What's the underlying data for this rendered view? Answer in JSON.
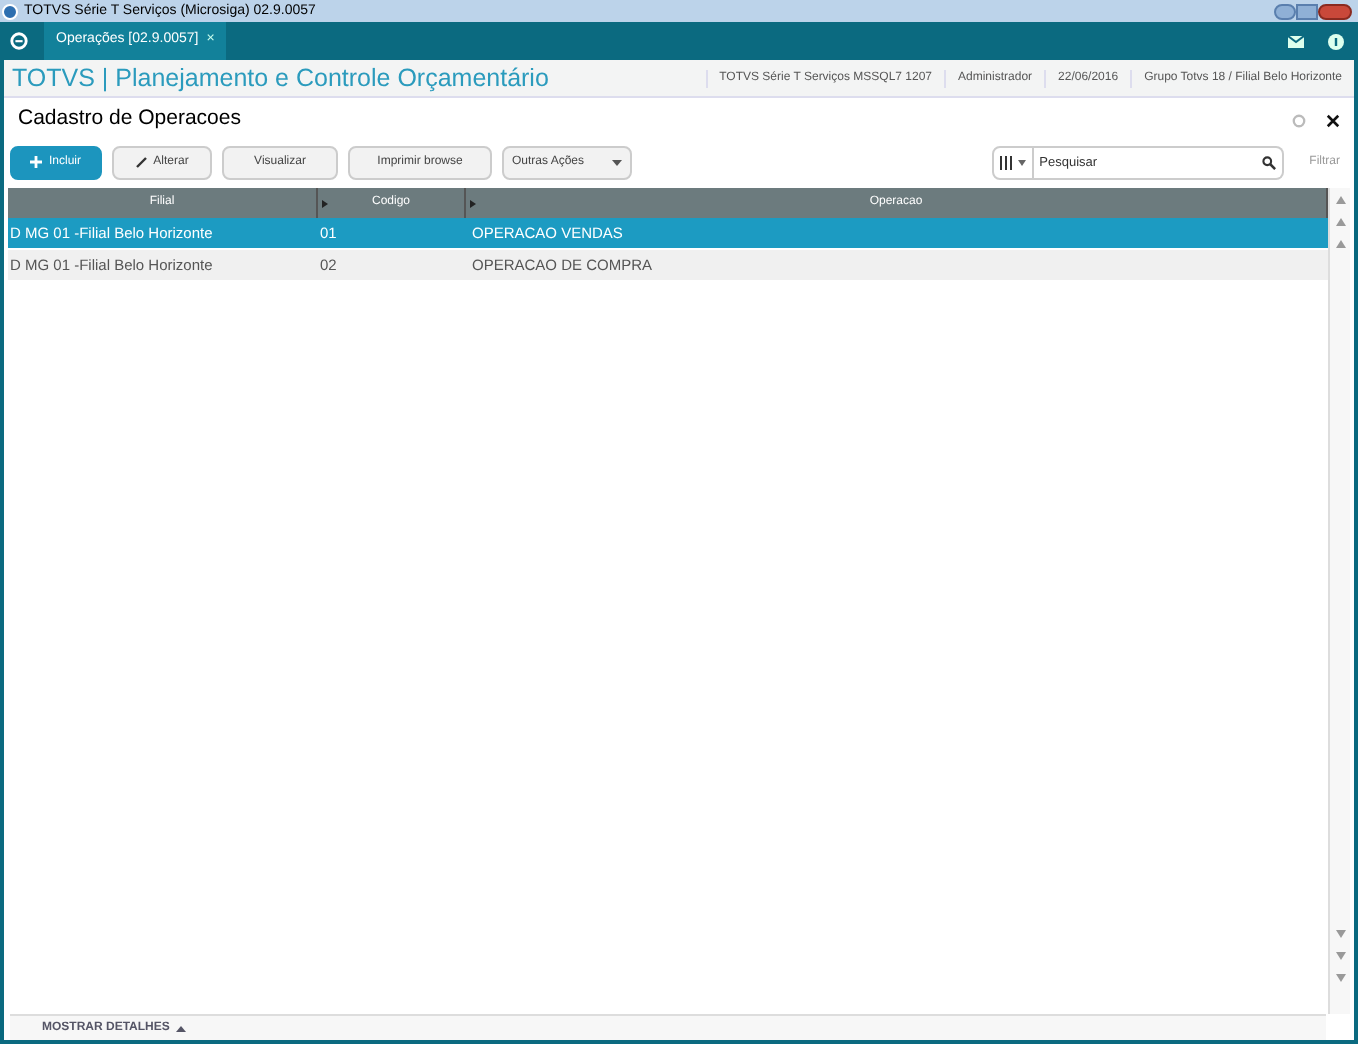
{
  "window": {
    "title": "TOTVS Série T Serviços (Microsiga) 02.9.0057"
  },
  "tabs": [
    {
      "label": "Operações [02.9.0057]",
      "selected": true,
      "close": "×"
    }
  ],
  "header": {
    "app_title": "TOTVS | Planejamento e Controle Orçamentário",
    "info": [
      "TOTVS Série T Serviços MSSQL7 1207",
      "Administrador",
      "22/06/2016",
      "Grupo Totvs 18 / Filial Belo Horizonte"
    ]
  },
  "page_title": "Cadastro de Operacoes",
  "buttons": [
    {
      "label": "Incluir",
      "kind": "primary"
    },
    {
      "label": "Alterar",
      "kind": "edit"
    },
    {
      "label": "Visualizar",
      "kind": "plain"
    },
    {
      "label": "Imprimir browse",
      "kind": "plain"
    },
    {
      "label": "Outras Ações",
      "kind": "dropdown"
    }
  ],
  "search": {
    "placeholder": "Pesquisar"
  },
  "filter_link": "Filtrar",
  "table": {
    "columns": [
      "Filial",
      "Codigo",
      "Operacao"
    ],
    "rows": [
      {
        "cells": [
          "D MG 01 -Filial Belo Horizonte",
          "01",
          "OPERACAO VENDAS"
        ],
        "selected": true
      },
      {
        "cells": [
          "D MG 01 -Filial Belo Horizonte",
          "02",
          "OPERACAO DE COMPRA"
        ],
        "selected": false
      }
    ]
  },
  "footer": {
    "details_toggle": "MOSTRAR DETALHES"
  }
}
